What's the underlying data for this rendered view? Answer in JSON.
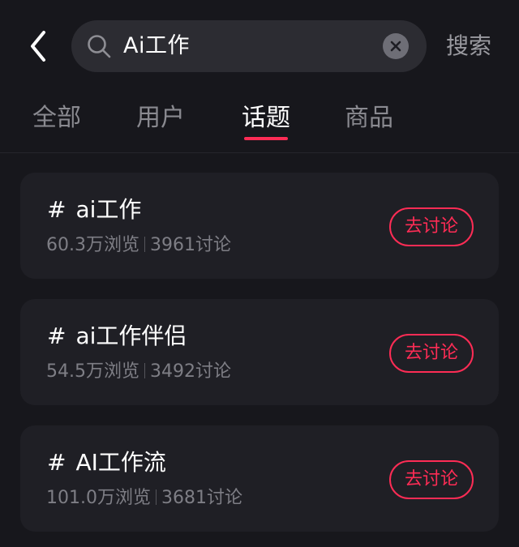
{
  "header": {
    "back_icon": "chevron-left-icon",
    "search_icon": "search-icon",
    "search_value": "Ai工作",
    "clear_icon": "clear-icon",
    "submit_label": "搜索"
  },
  "tabs": [
    {
      "label": "全部",
      "active": false
    },
    {
      "label": "用户",
      "active": false
    },
    {
      "label": "话题",
      "active": true
    },
    {
      "label": "商品",
      "active": false
    }
  ],
  "accent_color": "#fe2c55",
  "topics": [
    {
      "hash": "#",
      "title": "ai工作",
      "views": "60.3万浏览",
      "discussions": "3961讨论",
      "action_label": "去讨论"
    },
    {
      "hash": "#",
      "title": "ai工作伴侣",
      "views": "54.5万浏览",
      "discussions": "3492讨论",
      "action_label": "去讨论"
    },
    {
      "hash": "#",
      "title": "AI工作流",
      "views": "101.0万浏览",
      "discussions": "3681讨论",
      "action_label": "去讨论"
    }
  ]
}
